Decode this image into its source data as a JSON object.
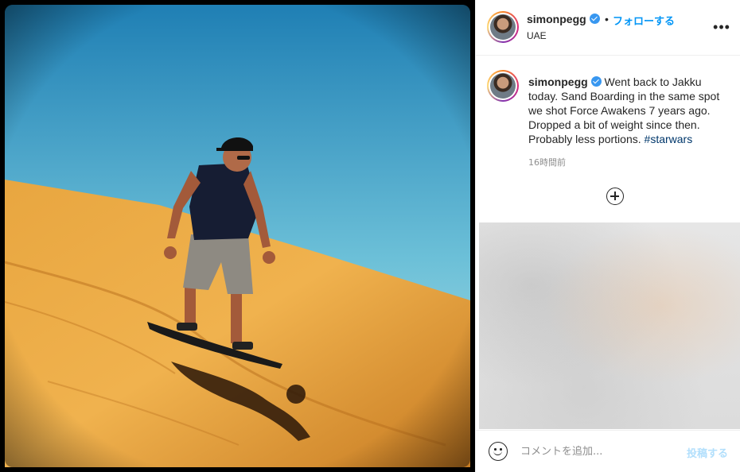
{
  "post": {
    "username": "simonpegg",
    "follow_label": "フォローする",
    "dot": "•",
    "location": "UAE",
    "more_label": "•••",
    "caption": {
      "username": "simonpegg",
      "text": " Went back to Jakku today. Sand Boarding in the same spot we shot Force Awakens 7 years ago. Dropped a bit of weight since then. Probably less portions. ",
      "hashtag": "#starwars"
    },
    "timestamp": "16時間前"
  },
  "comment": {
    "placeholder": "コメントを追加...",
    "post_label": "投稿する"
  },
  "icons": {
    "verified": "verified-badge-icon",
    "more": "more-options-icon",
    "add": "plus-circle-icon",
    "emoji": "emoji-icon"
  },
  "colors": {
    "link": "#0095f6",
    "hashtag": "#00376b",
    "verified": "#3897f0",
    "post_disabled": "#b2dffc"
  }
}
